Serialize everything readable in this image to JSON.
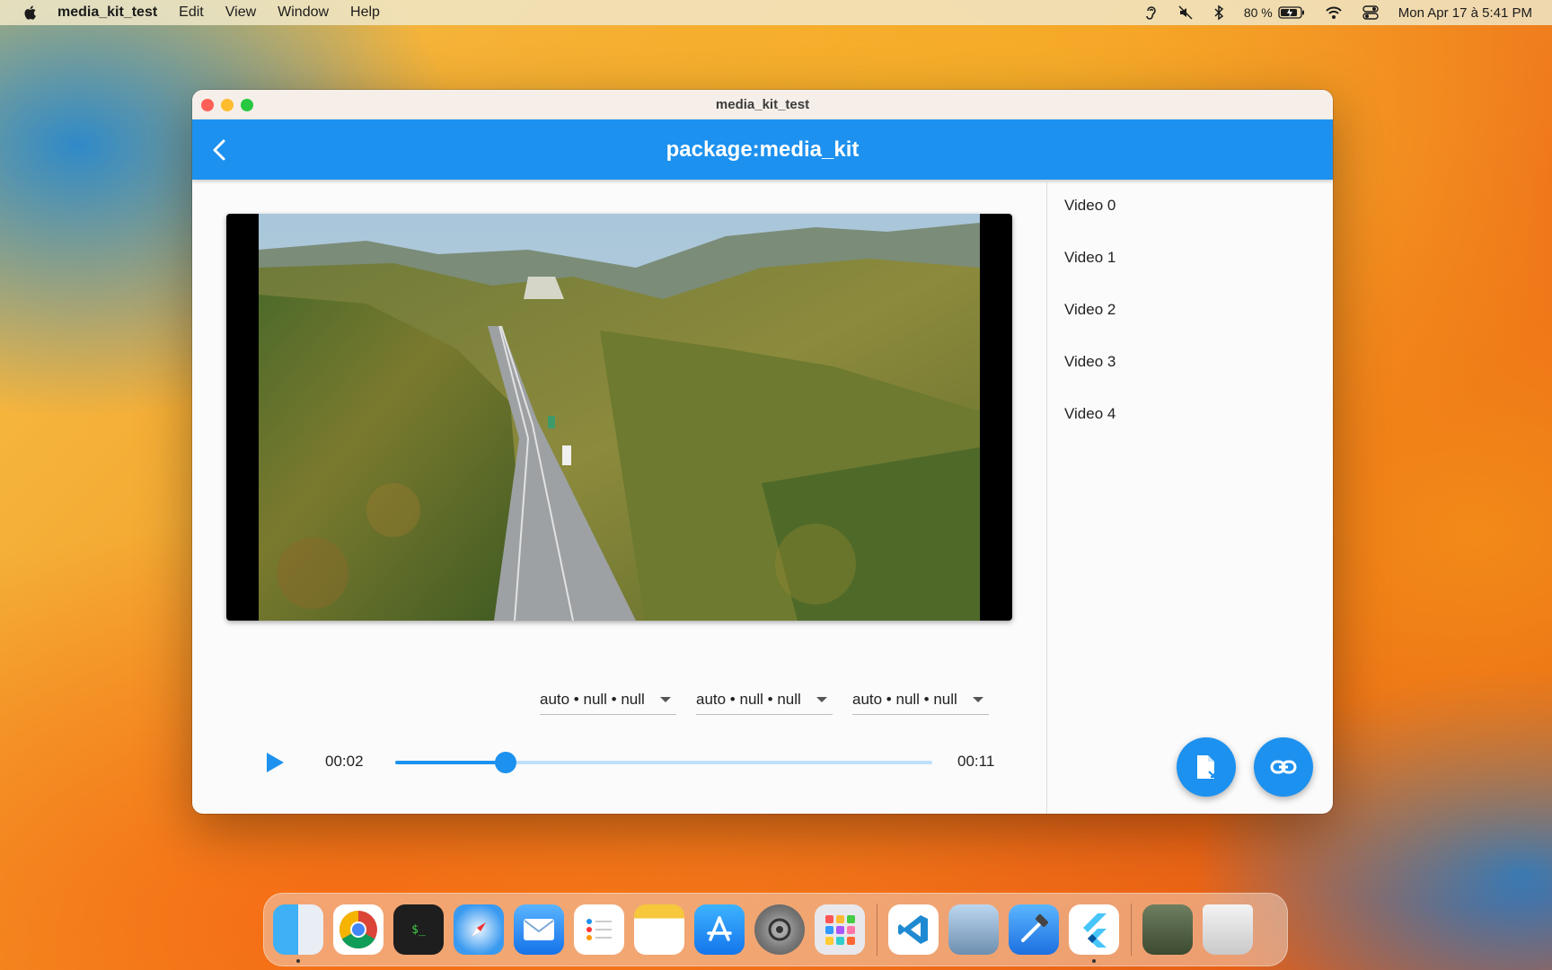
{
  "menubar": {
    "app_name": "media_kit_test",
    "items": [
      "Edit",
      "View",
      "Window",
      "Help"
    ],
    "battery": "80 %",
    "clock": "Mon Apr 17 à 5:41 PM"
  },
  "window": {
    "title": "media_kit_test",
    "appbar_title": "package:media_kit"
  },
  "player": {
    "position": "00:02",
    "duration": "00:11",
    "progress_fraction": 0.205,
    "dropdowns": [
      {
        "value": "auto • null • null"
      },
      {
        "value": "auto • null • null"
      },
      {
        "value": "auto • null • null"
      }
    ]
  },
  "playlist": [
    {
      "label": "Video 0"
    },
    {
      "label": "Video 1"
    },
    {
      "label": "Video 2"
    },
    {
      "label": "Video 3"
    },
    {
      "label": "Video 4"
    }
  ],
  "fabs": [
    "open-file-icon",
    "link-icon"
  ],
  "dock": {
    "apps": [
      "Finder",
      "Chrome",
      "Terminal",
      "Safari",
      "Mail",
      "Reminders",
      "Notes",
      "App Store",
      "System Settings",
      "Launchpad",
      "VS Code",
      "Preview",
      "Xcode",
      "Flutter",
      "Video Folder",
      "Trash"
    ]
  },
  "colors": {
    "accent": "#1d91ef",
    "track": "#bfe0fa"
  }
}
